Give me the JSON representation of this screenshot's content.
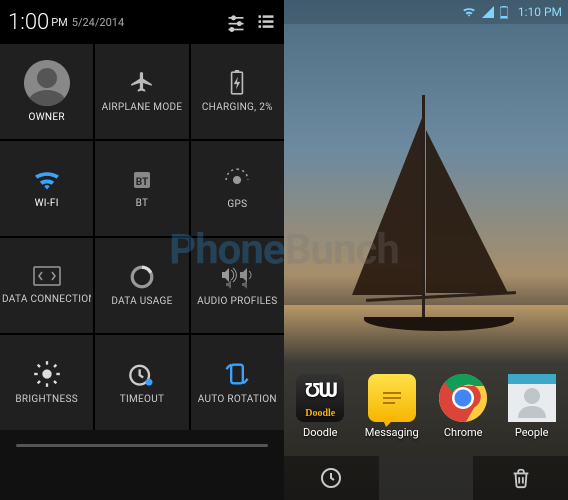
{
  "watermark": {
    "part1": "Phone",
    "part2": "Bunch"
  },
  "left": {
    "status": {
      "time": "1:00",
      "ampm": "PM",
      "date": "5/24/2014"
    },
    "tiles": [
      {
        "label": "OWNER"
      },
      {
        "label": "AIRPLANE MODE"
      },
      {
        "label": "CHARGING, 2%"
      },
      {
        "label": "WI-FI"
      },
      {
        "label": "BT"
      },
      {
        "label": "GPS"
      },
      {
        "label": "DATA CONNECTION"
      },
      {
        "label": "DATA USAGE"
      },
      {
        "label": "AUDIO PROFILES"
      },
      {
        "label": "BRIGHTNESS"
      },
      {
        "label": "TIMEOUT"
      },
      {
        "label": "AUTO ROTATION"
      }
    ]
  },
  "right": {
    "status": {
      "time": "1:10 PM"
    },
    "apps": [
      {
        "label": "Doodle"
      },
      {
        "label": "Messaging"
      },
      {
        "label": "Chrome"
      },
      {
        "label": "People"
      }
    ]
  }
}
